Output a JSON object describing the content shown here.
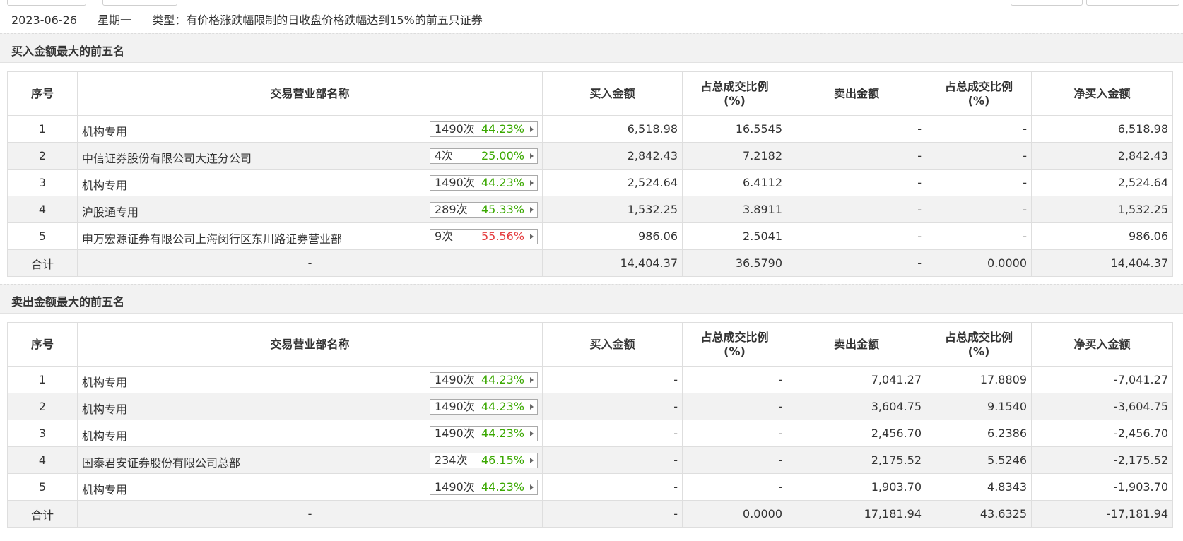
{
  "info": {
    "date": "2023-06-26",
    "weekday": "星期一",
    "type": "类型：有价格涨跌幅限制的日收盘价格跌幅达到15%的前五只证券"
  },
  "headers": {
    "idx": "序号",
    "name": "交易营业部名称",
    "buy": "买入金额",
    "buy_ratio_1": "占总成交比例",
    "buy_ratio_2": "(%)",
    "sell": "卖出金额",
    "sell_ratio_1": "占总成交比例",
    "sell_ratio_2": "(%)",
    "net": "净买入金额"
  },
  "buy_section": {
    "title": "买入金额最大的前五名",
    "rows": [
      {
        "idx": "1",
        "name": "机构专用",
        "count": "1490次",
        "pct": "44.23%",
        "pct_color": "green",
        "buy": "6,518.98",
        "buy_ratio": "16.5545",
        "sell": "-",
        "sell_ratio": "-",
        "net": "6,518.98"
      },
      {
        "idx": "2",
        "name": "中信证券股份有限公司大连分公司",
        "count": "4次",
        "pct": "25.00%",
        "pct_color": "green",
        "buy": "2,842.43",
        "buy_ratio": "7.2182",
        "sell": "-",
        "sell_ratio": "-",
        "net": "2,842.43"
      },
      {
        "idx": "3",
        "name": "机构专用",
        "count": "1490次",
        "pct": "44.23%",
        "pct_color": "green",
        "buy": "2,524.64",
        "buy_ratio": "6.4112",
        "sell": "-",
        "sell_ratio": "-",
        "net": "2,524.64"
      },
      {
        "idx": "4",
        "name": "沪股通专用",
        "count": "289次",
        "pct": "45.33%",
        "pct_color": "green",
        "buy": "1,532.25",
        "buy_ratio": "3.8911",
        "sell": "-",
        "sell_ratio": "-",
        "net": "1,532.25"
      },
      {
        "idx": "5",
        "name": "申万宏源证券有限公司上海闵行区东川路证券营业部",
        "count": "9次",
        "pct": "55.56%",
        "pct_color": "red",
        "buy": "986.06",
        "buy_ratio": "2.5041",
        "sell": "-",
        "sell_ratio": "-",
        "net": "986.06"
      }
    ],
    "total": {
      "label": "合计",
      "name": "-",
      "buy": "14,404.37",
      "buy_ratio": "36.5790",
      "sell": "-",
      "sell_ratio": "0.0000",
      "net": "14,404.37"
    }
  },
  "sell_section": {
    "title": "卖出金额最大的前五名",
    "rows": [
      {
        "idx": "1",
        "name": "机构专用",
        "count": "1490次",
        "pct": "44.23%",
        "pct_color": "green",
        "buy": "-",
        "buy_ratio": "-",
        "sell": "7,041.27",
        "sell_ratio": "17.8809",
        "net": "-7,041.27"
      },
      {
        "idx": "2",
        "name": "机构专用",
        "count": "1490次",
        "pct": "44.23%",
        "pct_color": "green",
        "buy": "-",
        "buy_ratio": "-",
        "sell": "3,604.75",
        "sell_ratio": "9.1540",
        "net": "-3,604.75"
      },
      {
        "idx": "3",
        "name": "机构专用",
        "count": "1490次",
        "pct": "44.23%",
        "pct_color": "green",
        "buy": "-",
        "buy_ratio": "-",
        "sell": "2,456.70",
        "sell_ratio": "6.2386",
        "net": "-2,456.70"
      },
      {
        "idx": "4",
        "name": "国泰君安证券股份有限公司总部",
        "count": "234次",
        "pct": "46.15%",
        "pct_color": "green",
        "buy": "-",
        "buy_ratio": "-",
        "sell": "2,175.52",
        "sell_ratio": "5.5246",
        "net": "-2,175.52"
      },
      {
        "idx": "5",
        "name": "机构专用",
        "count": "1490次",
        "pct": "44.23%",
        "pct_color": "green",
        "buy": "-",
        "buy_ratio": "-",
        "sell": "1,903.70",
        "sell_ratio": "4.8343",
        "net": "-1,903.70"
      }
    ],
    "total": {
      "label": "合计",
      "name": "-",
      "buy": "-",
      "buy_ratio": "0.0000",
      "sell": "17,181.94",
      "sell_ratio": "43.6325",
      "net": "-17,181.94"
    }
  },
  "colors": {
    "up": "#e4393c",
    "down": "#3aa800",
    "text": "#333333",
    "header_bg": "#f2f2f2"
  }
}
